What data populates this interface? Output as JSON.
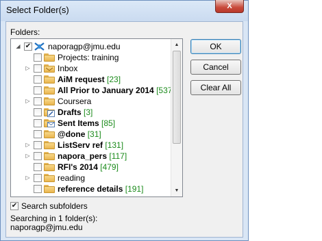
{
  "window": {
    "title": "Select Folder(s)",
    "close_symbol": "X"
  },
  "folders_label": "Folders:",
  "tree": [
    {
      "label": "naporagp@jmu.edu",
      "count": "",
      "bold": false,
      "checked": true,
      "expand": "open",
      "icon": "mailbox-icon",
      "level": 0
    },
    {
      "label": "Projects: training",
      "count": "",
      "bold": false,
      "checked": false,
      "expand": "",
      "icon": "folder-icon",
      "level": 1
    },
    {
      "label": "Inbox",
      "count": "",
      "bold": false,
      "checked": false,
      "expand": "closed",
      "icon": "inbox-icon",
      "level": 1
    },
    {
      "label": "AiM request",
      "count": "[23]",
      "bold": true,
      "checked": false,
      "expand": "",
      "icon": "folder-icon",
      "level": 1
    },
    {
      "label": "All Prior to January 2014",
      "count": "[537",
      "bold": true,
      "checked": false,
      "expand": "",
      "icon": "folder-icon",
      "level": 1
    },
    {
      "label": "Coursera",
      "count": "",
      "bold": false,
      "checked": false,
      "expand": "closed",
      "icon": "folder-icon",
      "level": 1
    },
    {
      "label": "Drafts",
      "count": "[3]",
      "bold": true,
      "checked": false,
      "expand": "",
      "icon": "drafts-icon",
      "level": 1
    },
    {
      "label": "Sent Items",
      "count": "[85]",
      "bold": true,
      "checked": false,
      "expand": "",
      "icon": "sent-items-icon",
      "level": 1
    },
    {
      "label": "@done",
      "count": "[31]",
      "bold": true,
      "checked": false,
      "expand": "",
      "icon": "folder-icon",
      "level": 1
    },
    {
      "label": "ListServ ref",
      "count": "[131]",
      "bold": true,
      "checked": false,
      "expand": "closed",
      "icon": "folder-icon",
      "level": 1
    },
    {
      "label": "napora_pers",
      "count": "[117]",
      "bold": true,
      "checked": false,
      "expand": "closed",
      "icon": "folder-icon",
      "level": 1
    },
    {
      "label": "RFI's 2014",
      "count": "[479]",
      "bold": true,
      "checked": false,
      "expand": "",
      "icon": "folder-icon",
      "level": 1
    },
    {
      "label": "reading",
      "count": "",
      "bold": false,
      "checked": false,
      "expand": "closed",
      "icon": "folder-icon",
      "level": 1
    },
    {
      "label": "reference details",
      "count": "[191]",
      "bold": true,
      "checked": false,
      "expand": "",
      "icon": "folder-icon",
      "level": 1
    }
  ],
  "buttons": {
    "ok": "OK",
    "cancel": "Cancel",
    "clear_all": "Clear All"
  },
  "search_subfolders": {
    "label": "Search subfolders",
    "checked": true
  },
  "searching_in": "Searching in 1 folder(s):",
  "searching_folder": "naporagp@jmu.edu",
  "colors": {
    "count_green": "#1a8a1a",
    "window_frame": "#d9e6f5",
    "close_red": "#c94a3b"
  }
}
